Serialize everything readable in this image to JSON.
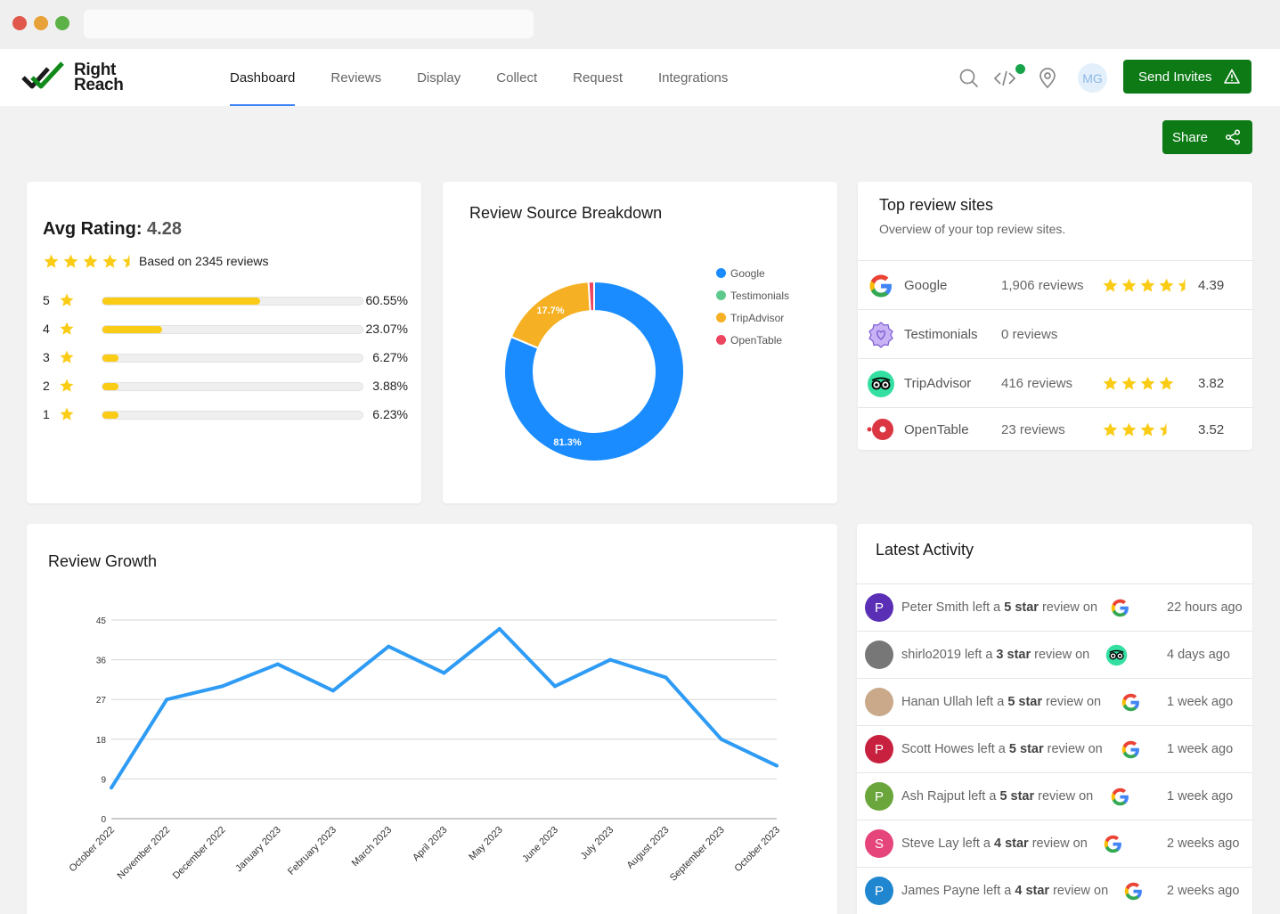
{
  "nav": {
    "brand_line1": "Right",
    "brand_line2": "Reach",
    "links": [
      "Dashboard",
      "Reviews",
      "Display",
      "Collect",
      "Request",
      "Integrations"
    ],
    "active": "Dashboard",
    "avatar_initials": "MG",
    "send_invites_label": "Send Invites",
    "share_label": "Share"
  },
  "rating": {
    "title_label": "Avg Rating:",
    "value": "4.28",
    "based_on": "Based on 2345 reviews",
    "stars": 4.5,
    "bars": [
      {
        "stars": "5",
        "percent": "60.55%",
        "fill": 0.6055
      },
      {
        "stars": "4",
        "percent": "23.07%",
        "fill": 0.2307
      },
      {
        "stars": "3",
        "percent": "6.27%",
        "fill": 0.0627
      },
      {
        "stars": "2",
        "percent": "3.88%",
        "fill": 0.0388
      },
      {
        "stars": "1",
        "percent": "6.23%",
        "fill": 0.0623
      }
    ]
  },
  "source": {
    "title": "Review Source Breakdown",
    "legend": [
      "Google",
      "Testimonials",
      "TripAdvisor",
      "OpenTable"
    ],
    "colors": {
      "Google": "#1a8cff",
      "Testimonials": "#5ec98c",
      "TripAdvisor": "#f6b023",
      "OpenTable": "#ec4560"
    }
  },
  "chart_data": [
    {
      "type": "pie",
      "title": "Review Source Breakdown",
      "labels": [
        "Google",
        "Testimonials",
        "TripAdvisor",
        "OpenTable"
      ],
      "values": [
        81.3,
        0,
        17.7,
        1.0
      ],
      "value_labels": [
        "81.3%",
        "",
        "17.7%",
        ""
      ],
      "donut": true,
      "legend": "right"
    },
    {
      "type": "line",
      "title": "Review Growth",
      "categories": [
        "October 2022",
        "November 2022",
        "December 2022",
        "January 2023",
        "February 2023",
        "March 2023",
        "April 2023",
        "May 2023",
        "June 2023",
        "July 2023",
        "August 2023",
        "September 2023",
        "October 2023"
      ],
      "series": [
        {
          "values": [
            7,
            27,
            30,
            35,
            29,
            39,
            33,
            43,
            30,
            36,
            32,
            18,
            12
          ],
          "color": "#2e9bf5"
        }
      ],
      "yticks": [
        0,
        9,
        18,
        27,
        36,
        45
      ],
      "ylim": [
        0,
        45
      ],
      "grid": true
    }
  ],
  "sites": {
    "title": "Top review sites",
    "subtitle": "Overview of your top review sites.",
    "rows": [
      {
        "name": "Google",
        "count": "1,906 reviews",
        "score": "4.39",
        "stars": 4.5,
        "icon": "google-icon"
      },
      {
        "name": "Testimonials",
        "count": "0 reviews",
        "score": "",
        "stars": 0,
        "icon": "testimonials-icon"
      },
      {
        "name": "TripAdvisor",
        "count": "416 reviews",
        "score": "3.82",
        "stars": 4,
        "icon": "tripadvisor-icon"
      },
      {
        "name": "OpenTable",
        "count": "23 reviews",
        "score": "3.52",
        "stars": 3.5,
        "icon": "opentable-icon"
      }
    ]
  },
  "activity": {
    "title": "Latest Activity",
    "rows": [
      {
        "user": "Peter Smith",
        "mid": " left a ",
        "stars": "5 star",
        "tail": " review on",
        "time": "22 hours ago",
        "avatar": "P",
        "avatar_color": "#5b2fb5",
        "source": "google-icon"
      },
      {
        "user": "shirlo2019",
        "mid": " left a ",
        "stars": "3 star",
        "tail": " review on",
        "time": "4 days ago",
        "avatar": "",
        "avatar_color": "#777777",
        "source": "tripadvisor-icon"
      },
      {
        "user": "Hanan Ullah",
        "mid": " left a ",
        "stars": "5 star",
        "tail": " review on",
        "time": "1 week ago",
        "avatar": "",
        "avatar_color": "#c9a98a",
        "source": "google-icon"
      },
      {
        "user": "Scott Howes",
        "mid": " left a ",
        "stars": "5 star",
        "tail": " review on",
        "time": "1 week ago",
        "avatar": "P",
        "avatar_color": "#c8213f",
        "source": "google-icon"
      },
      {
        "user": "Ash Rajput",
        "mid": " left a ",
        "stars": "5 star",
        "tail": " review on",
        "time": "1 week ago",
        "avatar": "P",
        "avatar_color": "#6aa63b",
        "source": "google-icon"
      },
      {
        "user": "Steve Lay",
        "mid": " left a ",
        "stars": "4 star",
        "tail": " review on",
        "time": "2 weeks ago",
        "avatar": "S",
        "avatar_color": "#e5457a",
        "source": "google-icon"
      },
      {
        "user": "James Payne",
        "mid": " left a ",
        "stars": "4 star",
        "tail": " review on",
        "time": "2 weeks ago",
        "avatar": "P",
        "avatar_color": "#1f86cf",
        "source": "google-icon"
      }
    ]
  },
  "growth": {
    "title": "Review Growth"
  }
}
